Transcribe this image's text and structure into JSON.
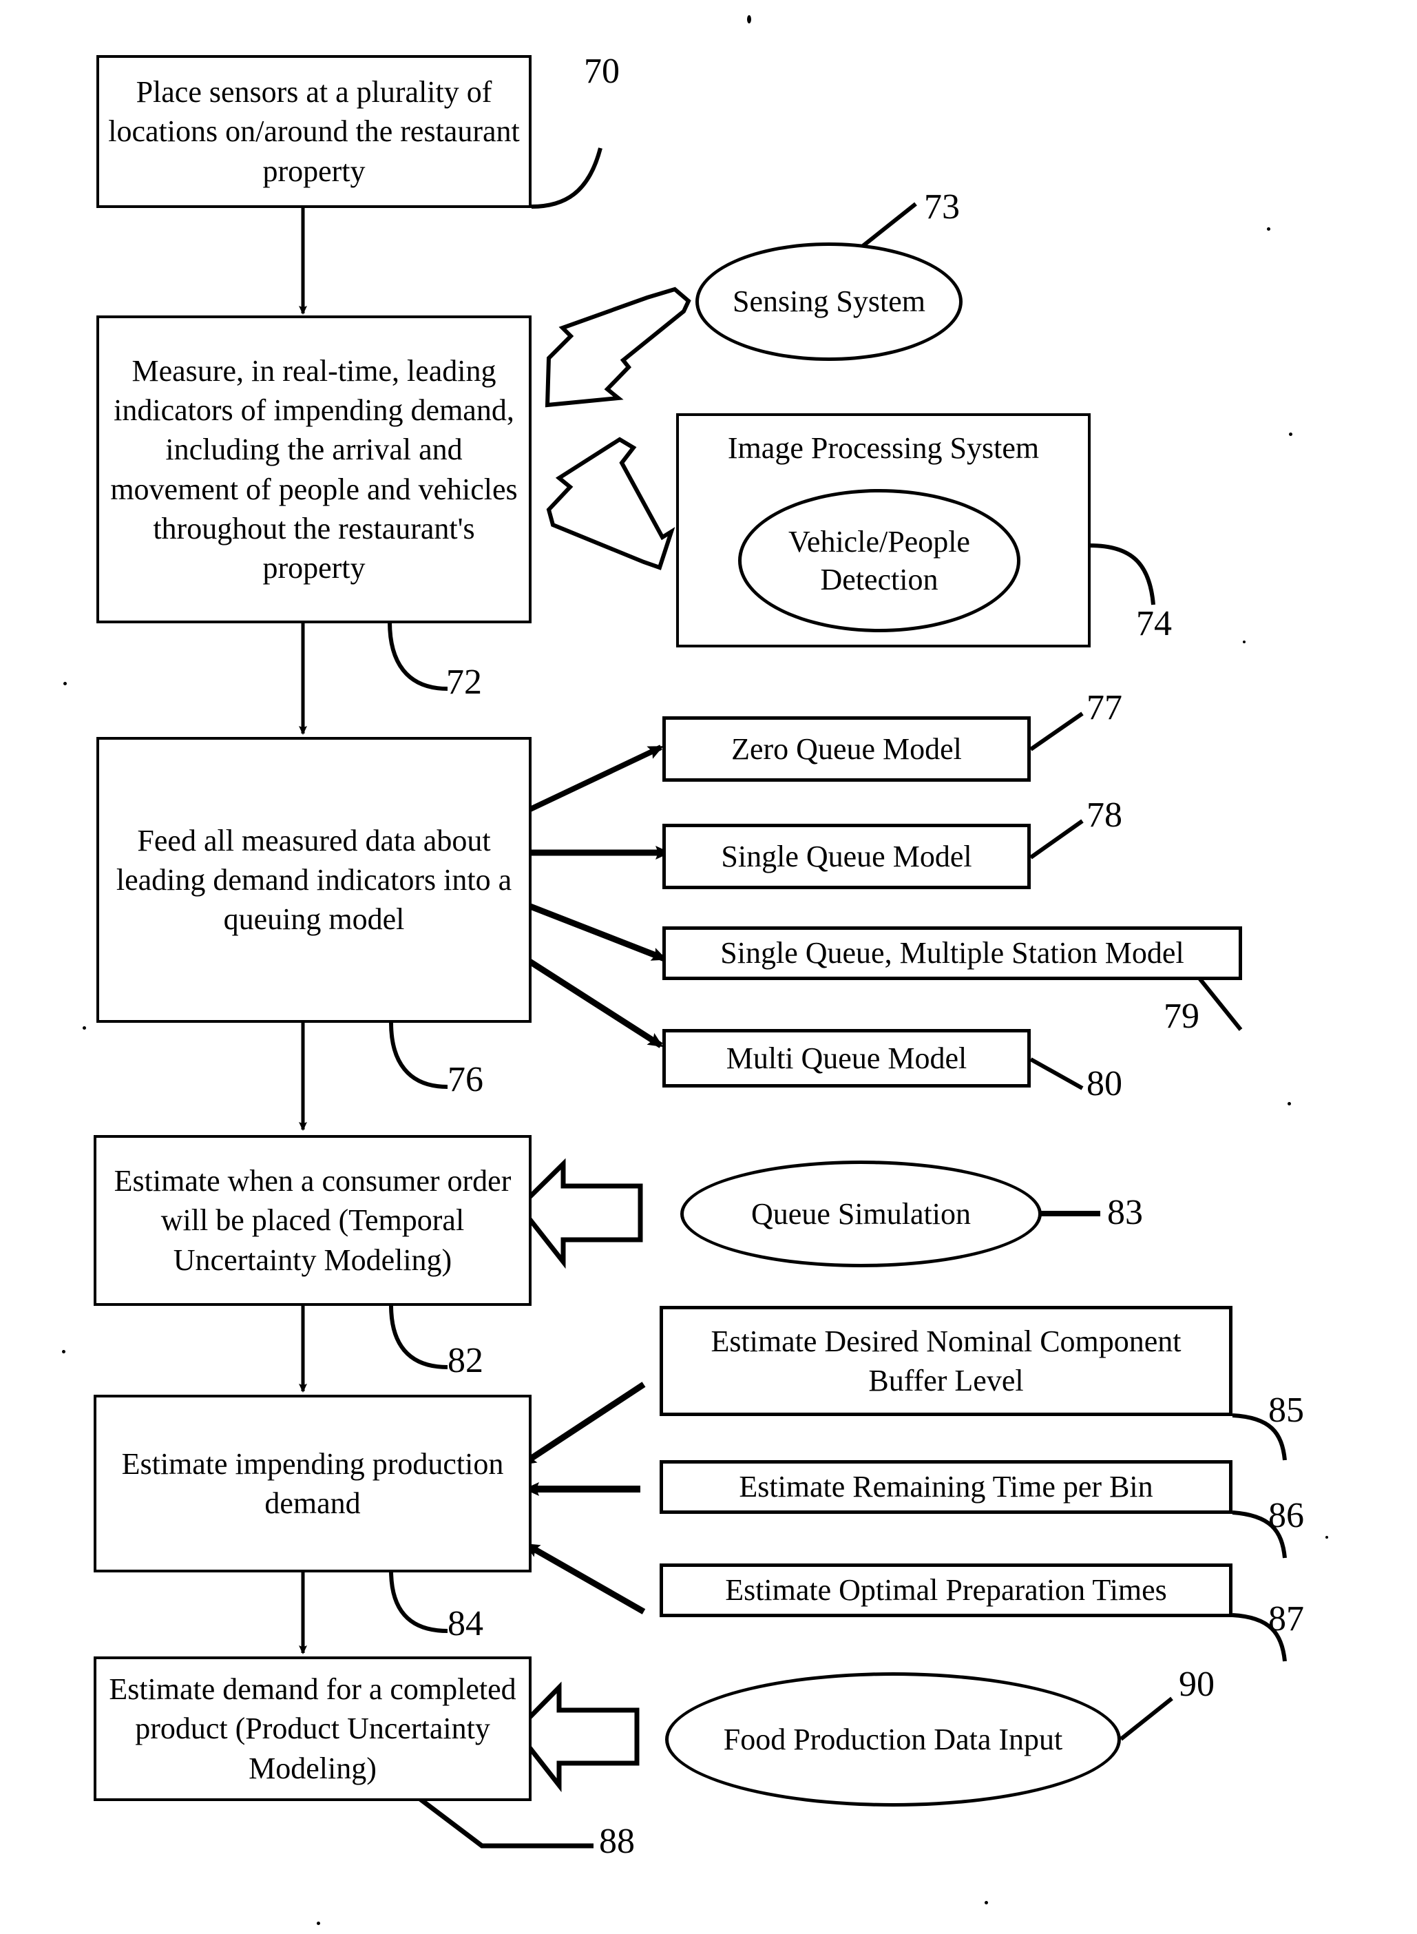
{
  "figure": {
    "type": "patent-flowchart",
    "title": "Restaurant demand prediction flowchart"
  },
  "process_boxes": [
    {
      "id": "box70",
      "ref": "70",
      "text": "Place sensors at a plurality of locations on/around the restaurant property"
    },
    {
      "id": "box72",
      "ref": "72",
      "text": "Measure, in real-time, leading indicators of impending demand, including the arrival and movement of people and vehicles throughout the restaurant's property"
    },
    {
      "id": "box76",
      "ref": "76",
      "text": "Feed all measured data about leading demand indicators into a queuing model"
    },
    {
      "id": "box82",
      "ref": "82",
      "text": "Estimate when a consumer order will be placed (Temporal Uncertainty Modeling)"
    },
    {
      "id": "box84",
      "ref": "84",
      "text": "Estimate impending production demand"
    },
    {
      "id": "box88",
      "ref": "88",
      "text": "Estimate demand for a completed product (Product Uncertainty Modeling)"
    }
  ],
  "queue_models": [
    {
      "id": "box77",
      "ref": "77",
      "text": "Zero Queue Model"
    },
    {
      "id": "box78",
      "ref": "78",
      "text": "Single Queue Model"
    },
    {
      "id": "box79",
      "ref": "79",
      "text": "Single Queue, Multiple Station Model"
    },
    {
      "id": "box80",
      "ref": "80",
      "text": "Multi Queue Model"
    }
  ],
  "input_boxes": [
    {
      "id": "box85",
      "ref": "85",
      "text": "Estimate Desired Nominal Component Buffer Level"
    },
    {
      "id": "box86",
      "ref": "86",
      "text": "Estimate Remaining Time per Bin"
    },
    {
      "id": "box87",
      "ref": "87",
      "text": "Estimate Optimal Preparation Times"
    }
  ],
  "system_box": {
    "id": "box74",
    "ref": "74",
    "title": "Image Processing System",
    "inner_ellipse": {
      "text": "Vehicle/People Detection"
    }
  },
  "ellipses": [
    {
      "id": "ell73",
      "ref": "73",
      "text": "Sensing System"
    },
    {
      "id": "ell83",
      "ref": "83",
      "text": "Queue Simulation"
    },
    {
      "id": "ell90",
      "ref": "90",
      "text": "Food Production Data Input"
    }
  ],
  "reference_numerals": {
    "n70": "70",
    "n72": "72",
    "n73": "73",
    "n74": "74",
    "n76": "76",
    "n77": "77",
    "n78": "78",
    "n79": "79",
    "n80": "80",
    "n82": "82",
    "n83": "83",
    "n84": "84",
    "n85": "85",
    "n86": "86",
    "n87": "87",
    "n88": "88",
    "n90": "90"
  },
  "colors": {
    "ink": "#000000",
    "paper": "#ffffff"
  }
}
